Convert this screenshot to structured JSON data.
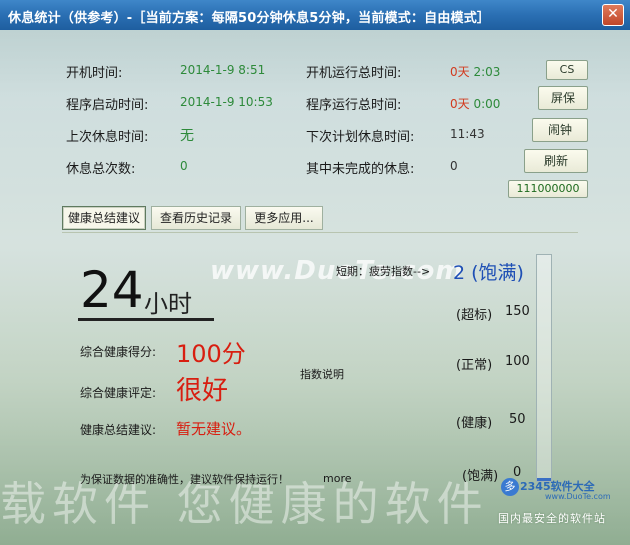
{
  "window": {
    "title": "休息统计（供参考）-［当前方案：每隔50分钟休息5分钟，当前模式：自由模式］",
    "close_icon": "close-icon"
  },
  "stats": {
    "boot_time_label": "开机时间:",
    "boot_time": "2014-1-9 8:51",
    "boot_total_label": "开机运行总时间:",
    "boot_total_days": "0天",
    "boot_total_time": "2:03",
    "prog_start_label": "程序启动时间:",
    "prog_start": "2014-1-9 10:53",
    "prog_total_label": "程序运行总时间:",
    "prog_total_days": "0天",
    "prog_total_time": "0:00",
    "last_rest_label": "上次休息时间:",
    "last_rest": "无",
    "next_rest_label": "下次计划休息时间:",
    "next_rest": "11:43",
    "rest_count_label": "休息总次数:",
    "rest_count": "0",
    "unfinished_label": "其中未完成的休息:",
    "unfinished": "0"
  },
  "side_buttons": {
    "cs": "CS",
    "screensaver": "屏保",
    "alarm": "闹钟",
    "refresh": "刷新",
    "code": "111000000"
  },
  "tabs": [
    "健康总结建议",
    "查看历史记录",
    "更多应用..."
  ],
  "summary": {
    "hours": "24",
    "hours_unit": "小时",
    "score_label": "综合健康得分:",
    "score": "100分",
    "rating_label": "综合健康评定:",
    "rating": "很好",
    "advice_label": "健康总结建议:",
    "advice": "暂无建议。",
    "index_explain": "指数说明"
  },
  "fatigue": {
    "label": "短期：疲劳指数-->",
    "value": "2 (饱满)",
    "levels": [
      {
        "label": "(超标)",
        "value": "150"
      },
      {
        "label": "(正常)",
        "value": "100"
      },
      {
        "label": "(健康)",
        "value": "50"
      },
      {
        "label": "(饱满)",
        "value": "0"
      }
    ],
    "gauge_fraction": 0.013
  },
  "footer": {
    "note": "为保证数据的准确性，建议软件保持运行！",
    "more": "more"
  },
  "watermarks": {
    "duote": "www.DuoTe.com",
    "faint": "载软件 您健康的软件",
    "brand": "2345软件大全",
    "brand_url": "www.DuoTe.com",
    "brand_foot": "国内最安全的软件站",
    "brand_logo": "多"
  }
}
